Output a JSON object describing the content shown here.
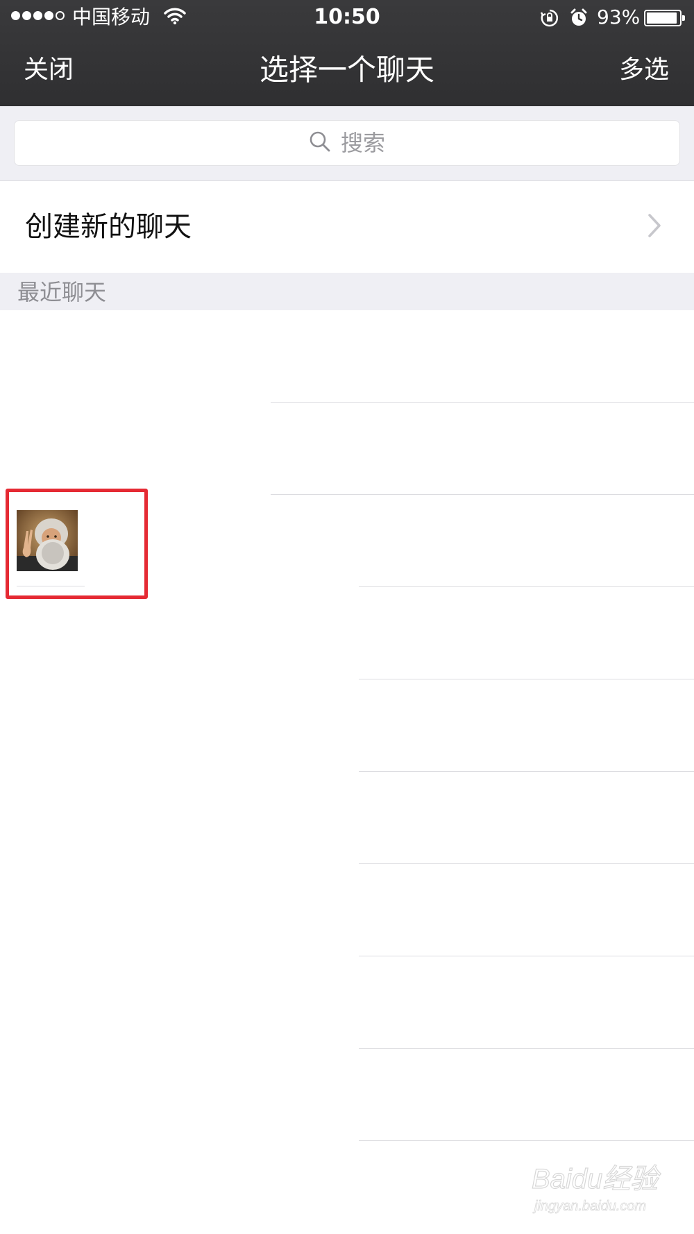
{
  "status_bar": {
    "carrier": "中国移动",
    "time": "10:50",
    "battery_percent": "93%",
    "battery_level": 0.93,
    "signal_bars": [
      true,
      true,
      true,
      true,
      false
    ]
  },
  "nav": {
    "left_label": "关闭",
    "title": "选择一个聊天",
    "right_label": "多选"
  },
  "search": {
    "placeholder": "搜索"
  },
  "create_chat": {
    "label": "创建新的聊天"
  },
  "recent": {
    "section_label": "最近聊天"
  },
  "watermark": {
    "brand": "Baidu经验",
    "url": "jingyan.baidu.com"
  },
  "colors": {
    "header_bg": "#333335",
    "section_bg": "#efeff4",
    "highlight": "#e52a33",
    "divider": "#dcdce0",
    "muted_text": "#8e8e93"
  }
}
